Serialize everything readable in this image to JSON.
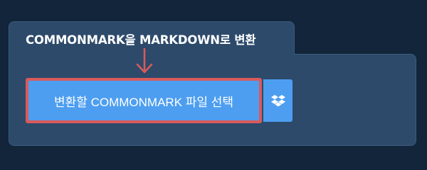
{
  "panel": {
    "title": "COMMONMARK을 MARKDOWN로 변환"
  },
  "file_select": {
    "label": "변환할 COMMONMARK 파일 선택",
    "dropbox_icon": "dropbox-icon"
  },
  "colors": {
    "background": "#13253a",
    "panel": "#2d4a6b",
    "button": "#4d9ef0",
    "highlight": "#d95a5a",
    "text": "#ffffff"
  }
}
